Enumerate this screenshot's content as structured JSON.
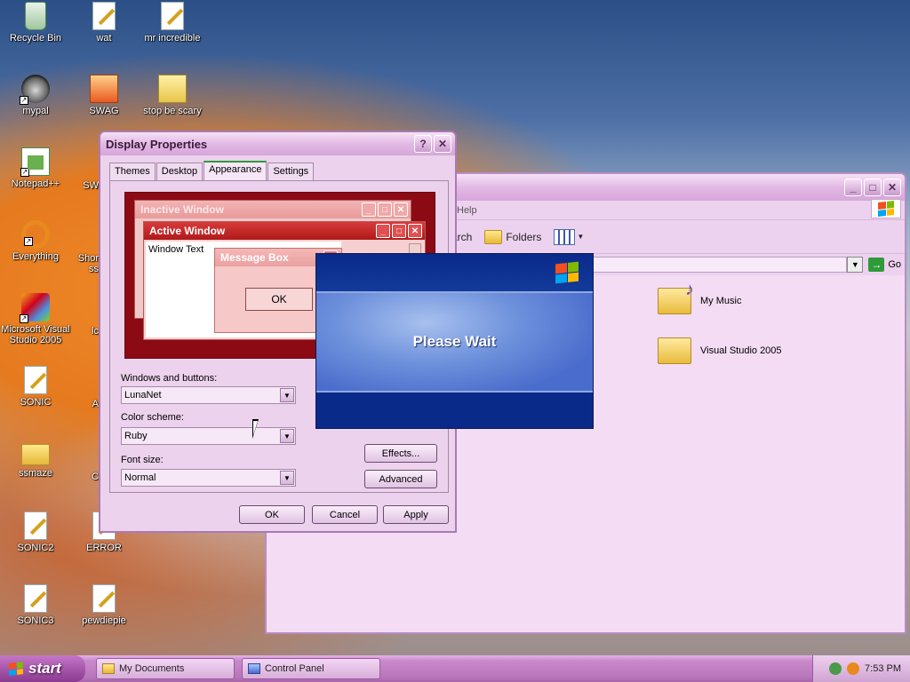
{
  "desktop": {
    "icons": [
      {
        "label": "Recycle Bin",
        "icon": "recycle-bin-icon"
      },
      {
        "label": "wat",
        "icon": "script-file-icon"
      },
      {
        "label": "mr incredible",
        "icon": "script-file-icon"
      },
      {
        "label": "mypal",
        "icon": "raccoon-app-icon"
      },
      {
        "label": "SWAG",
        "icon": "image-file-icon"
      },
      {
        "label": "stop be scary",
        "icon": "zip-folder-icon"
      },
      {
        "label": "Notepad++",
        "icon": "notepad-plus-icon"
      },
      {
        "label": "Everything",
        "icon": "everything-search-icon"
      },
      {
        "label": "Microsoft Visual Studio 2005",
        "icon": "visual-studio-icon"
      },
      {
        "label": "SONIC",
        "icon": "script-file-icon"
      },
      {
        "label": "ssmaze",
        "icon": "folder-icon"
      },
      {
        "label": "SONIC2",
        "icon": "script-file-icon"
      },
      {
        "label": "ERROR",
        "icon": "script-file-icon"
      },
      {
        "label": "SONIC3",
        "icon": "script-file-icon"
      },
      {
        "label": "pewdiepie",
        "icon": "script-file-icon"
      }
    ],
    "partial_labels": [
      "SW",
      "Shor",
      "ss",
      "lc",
      "A",
      "C"
    ]
  },
  "explorer": {
    "menu_help": "Help",
    "toolbar_search_partial": "arch",
    "toolbar_folders": "Folders",
    "go_label": "Go",
    "files": [
      {
        "label": "My Music",
        "icon": "music-folder-icon"
      },
      {
        "label": "Visual Studio 2005",
        "icon": "folder-icon"
      }
    ]
  },
  "dialog": {
    "title": "Display Properties",
    "tabs": [
      "Themes",
      "Desktop",
      "Appearance",
      "Settings"
    ],
    "active_tab": "Appearance",
    "preview": {
      "inactive_title": "Inactive Window",
      "active_title": "Active Window",
      "window_text": "Window Text",
      "message_title": "Message Box",
      "ok_label": "OK"
    },
    "windows_buttons_label": "Windows and buttons:",
    "windows_buttons_value": "LunaNet",
    "color_scheme_label": "Color scheme:",
    "color_scheme_value": "Ruby",
    "font_size_label": "Font size:",
    "font_size_value": "Normal",
    "effects_label": "Effects...",
    "advanced_label": "Advanced",
    "ok_label": "OK",
    "cancel_label": "Cancel",
    "apply_label": "Apply"
  },
  "splash": {
    "text": "Please Wait"
  },
  "taskbar": {
    "start_label": "start",
    "tasks": [
      {
        "label": "My Documents",
        "icon": "folder-icon"
      },
      {
        "label": "Control Panel",
        "icon": "control-panel-icon"
      }
    ],
    "clock": "7:53 PM"
  },
  "colors": {
    "dialog_bg": "#ecd2ec",
    "preview_bg": "#8b0a14",
    "splash_blue": "#0a2a8a",
    "taskbar": "#b976bb"
  }
}
